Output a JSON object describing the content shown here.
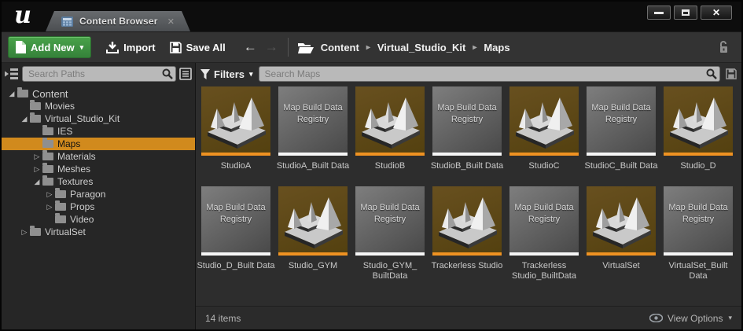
{
  "window": {
    "tab_label": "Content Browser",
    "controls": {
      "minimize": "minimize",
      "maximize": "maximize",
      "close": "close"
    }
  },
  "icons": {
    "tab_close": "✕",
    "caret_down": "▾",
    "back_arrow": "←",
    "forward_arrow": "→",
    "breadcrumb_separator": "▸",
    "tree_expanded": "◢",
    "tree_collapsed": "▷"
  },
  "toolbar": {
    "add_new_label": "Add New",
    "import_label": "Import",
    "save_all_label": "Save All"
  },
  "breadcrumb": {
    "items": [
      "Content",
      "Virtual_Studio_Kit",
      "Maps"
    ]
  },
  "sources": {
    "search_placeholder": "Search Paths",
    "tree": [
      {
        "label": "Content",
        "level": 0,
        "state": "expanded",
        "selected": false
      },
      {
        "label": "Movies",
        "level": 1,
        "state": "none",
        "selected": false
      },
      {
        "label": "Virtual_Studio_Kit",
        "level": 1,
        "state": "expanded",
        "selected": false
      },
      {
        "label": "IES",
        "level": 2,
        "state": "none",
        "selected": false
      },
      {
        "label": "Maps",
        "level": 2,
        "state": "none",
        "selected": true
      },
      {
        "label": "Materials",
        "level": 2,
        "state": "collapsed",
        "selected": false
      },
      {
        "label": "Meshes",
        "level": 2,
        "state": "collapsed",
        "selected": false
      },
      {
        "label": "Textures",
        "level": 2,
        "state": "expanded",
        "selected": false
      },
      {
        "label": "Paragon",
        "level": 3,
        "state": "collapsed",
        "selected": false
      },
      {
        "label": "Props",
        "level": 3,
        "state": "collapsed",
        "selected": false
      },
      {
        "label": "Video",
        "level": 3,
        "state": "none",
        "selected": false
      },
      {
        "label": "VirtualSet",
        "level": 1,
        "state": "collapsed",
        "selected": false
      }
    ]
  },
  "assets": {
    "filters_label": "Filters",
    "search_placeholder": "Search Maps",
    "registry_overlay": "Map Build Data Registry",
    "items": [
      {
        "name": "StudioA",
        "type": "map"
      },
      {
        "name": "StudioA_Built Data",
        "type": "registry"
      },
      {
        "name": "StudioB",
        "type": "map"
      },
      {
        "name": "StudioB_Built Data",
        "type": "registry"
      },
      {
        "name": "StudioC",
        "type": "map"
      },
      {
        "name": "StudioC_Built Data",
        "type": "registry"
      },
      {
        "name": "Studio_D",
        "type": "map"
      },
      {
        "name": "Studio_D_Built Data",
        "type": "registry"
      },
      {
        "name": "Studio_GYM",
        "type": "map"
      },
      {
        "name": "Studio_GYM_ BuiltData",
        "type": "registry"
      },
      {
        "name": "Trackerless Studio",
        "type": "map"
      },
      {
        "name": "Trackerless Studio_BuiltData",
        "type": "registry"
      },
      {
        "name": "VirtualSet",
        "type": "map"
      },
      {
        "name": "VirtualSet_Built Data",
        "type": "registry"
      }
    ],
    "status": "14 items",
    "view_options_label": "View Options"
  },
  "colors": {
    "selected_folder_bg": "#d18a1d",
    "map_strip": "#ef9222",
    "registry_strip": "#f6f6f6",
    "add_new_green": "#3f9340",
    "map_thumb_bg": "#5d4716"
  }
}
